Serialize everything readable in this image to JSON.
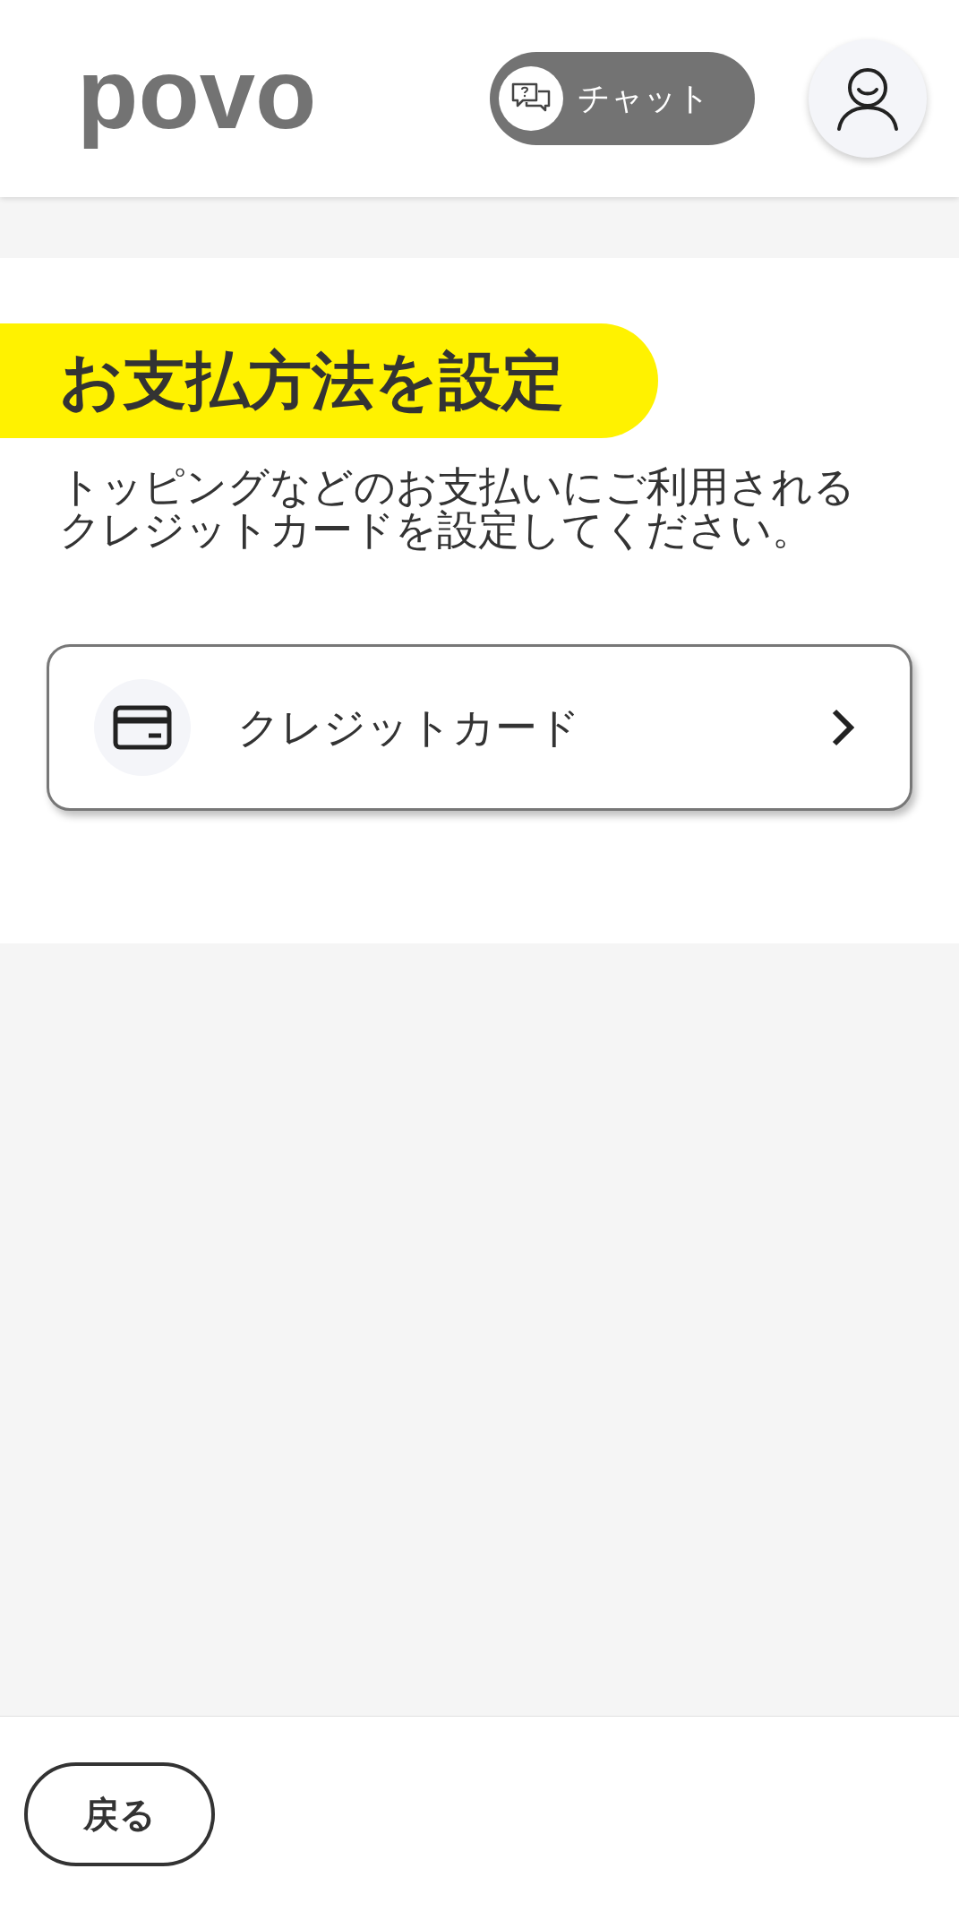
{
  "header": {
    "logo": "povo",
    "chat_button": "チャット"
  },
  "section": {
    "title": "お支払方法を設定",
    "description_lines": [
      "トッピングなどのお支払いにご利用される",
      "クレジットカードを設定してください。"
    ]
  },
  "payment_options": [
    {
      "label": "クレジットカード"
    }
  ],
  "footer": {
    "back_button": "戻る"
  }
}
